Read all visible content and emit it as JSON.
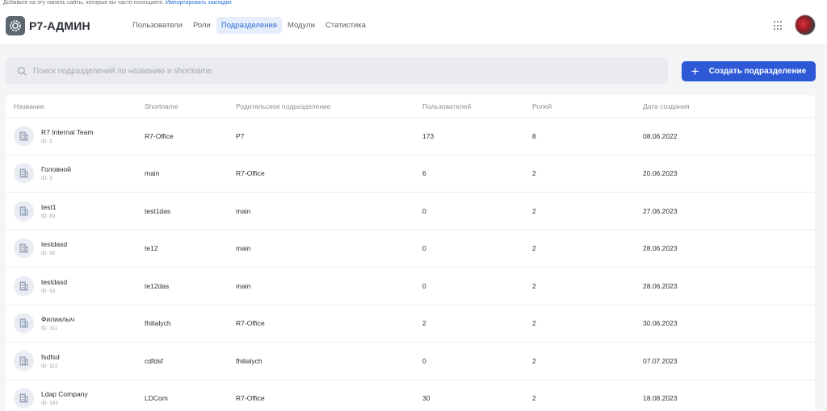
{
  "bookmarks_bar": {
    "text": "Добавьте на эту панель сайты, которые вы часто посещаете.",
    "link": "Импортировать закладки"
  },
  "header": {
    "logo": {
      "icon": "gear-icon",
      "text": "Р7-АДМИН"
    },
    "nav": [
      {
        "label": "Пользователи",
        "active": false
      },
      {
        "label": "Роли",
        "active": false
      },
      {
        "label": "Подразделения",
        "active": true
      },
      {
        "label": "Модули",
        "active": false
      },
      {
        "label": "Статистика",
        "active": false
      }
    ],
    "apps_icon": "apps-grid-icon",
    "avatar_icon": "user-avatar"
  },
  "toolbar": {
    "search": {
      "placeholder": "Поиск подразделений по названию и shortname",
      "value": ""
    },
    "create_button": {
      "label": "Создать подразделение",
      "icon": "plus-icon"
    }
  },
  "table": {
    "columns": [
      "Название",
      "Shortname",
      "Родительское подразделение",
      "Пользователей",
      "Ролей",
      "Дата создания"
    ],
    "rows": [
      {
        "name": "R7 Internal Team",
        "id": "ID: 2",
        "shortname": "R7-Office",
        "parent": "P7",
        "users": "173",
        "roles": "8",
        "created": "08.06.2022"
      },
      {
        "name": "Головной",
        "id": "ID: 3",
        "shortname": "main",
        "parent": "R7-Office",
        "users": "6",
        "roles": "2",
        "created": "20.06.2023"
      },
      {
        "name": "test1",
        "id": "ID: 83",
        "shortname": "test1das",
        "parent": "main",
        "users": "0",
        "roles": "2",
        "created": "27.06.2023"
      },
      {
        "name": "testdasd",
        "id": "ID: 92",
        "shortname": "te12",
        "parent": "main",
        "users": "0",
        "roles": "2",
        "created": "28.06.2023"
      },
      {
        "name": "testdasd",
        "id": "ID: 93",
        "shortname": "te12das",
        "parent": "main",
        "users": "0",
        "roles": "2",
        "created": "28.06.2023"
      },
      {
        "name": "Филиалыч",
        "id": "ID: 111",
        "shortname": "fhilialych",
        "parent": "R7-Office",
        "users": "2",
        "roles": "2",
        "created": "30.06.2023"
      },
      {
        "name": "fsdfsd",
        "id": "ID: 112",
        "shortname": "cdfdsf",
        "parent": "fhilialych",
        "users": "0",
        "roles": "2",
        "created": "07.07.2023"
      },
      {
        "name": "Ldap Company",
        "id": "ID: 153",
        "shortname": "LDCom",
        "parent": "R7-Office",
        "users": "30",
        "roles": "2",
        "created": "18.08.2023"
      }
    ],
    "row_icon": "building-icon"
  },
  "colors": {
    "accent": "#2d59d6",
    "nav_active_bg": "#e6eefb",
    "nav_active_text": "#2b6fd6"
  }
}
